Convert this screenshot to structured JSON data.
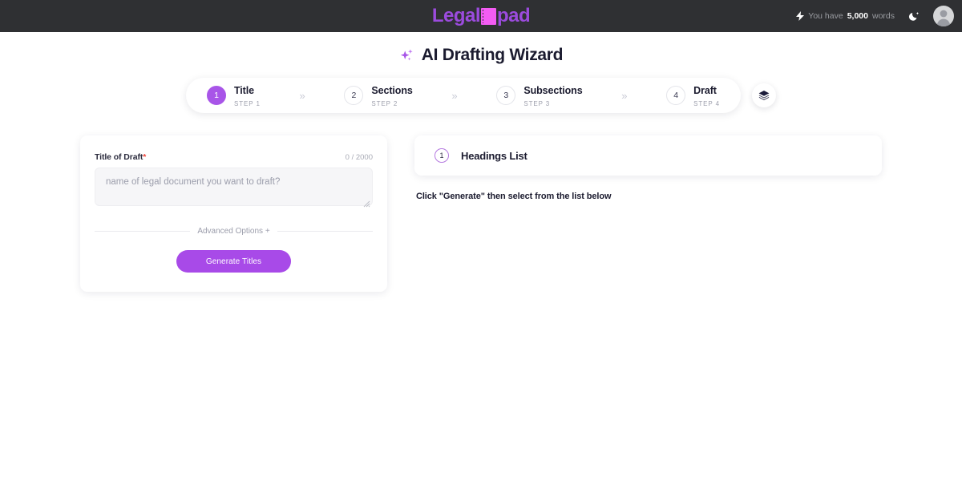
{
  "topbar": {
    "brand_left": "Legal",
    "brand_right": "pad",
    "brand_mark_icon": "notepad-icon",
    "bolt_icon": "lightning-bolt-icon",
    "words_prefix": "You have",
    "words_count": "5,000",
    "words_suffix": "words",
    "theme_toggle_icon": "moon-icon",
    "avatar_icon": "user-avatar-icon",
    "colors": {
      "bar_bg": "#2f3033",
      "brand_purple": "#9b4bdd",
      "brand_pink": "#f45cf4"
    }
  },
  "page": {
    "title": "AI Drafting Wizard",
    "title_icon": "sparkles-icon"
  },
  "stepper": {
    "separator": "»",
    "layers_button_icon": "layers-icon",
    "steps": [
      {
        "num": "1",
        "name": "Title",
        "sub": "STEP 1",
        "active": true
      },
      {
        "num": "2",
        "name": "Sections",
        "sub": "STEP 2",
        "active": false
      },
      {
        "num": "3",
        "name": "Subsections",
        "sub": "STEP 3",
        "active": false
      },
      {
        "num": "4",
        "name": "Draft",
        "sub": "STEP 4",
        "active": false
      }
    ],
    "colors": {
      "active": "#a855e8",
      "inactive_border": "#e4e5ea"
    }
  },
  "form": {
    "field_label": "Title of Draft",
    "required_mark": "*",
    "counter": "0 / 2000",
    "input_value": "",
    "input_placeholder": "name of legal document you want to draft?",
    "advanced_options": "Advanced Options  +",
    "generate_button": "Generate Titles",
    "colors": {
      "button": "#a84ae8",
      "required": "#f0453a",
      "input_bg": "#f6f6f8"
    }
  },
  "headings_panel": {
    "badge_num": "1",
    "title": "Headings List",
    "hint": "Click \"Generate\" then select from the list below",
    "colors": {
      "badge_border": "#b57ae0"
    }
  }
}
